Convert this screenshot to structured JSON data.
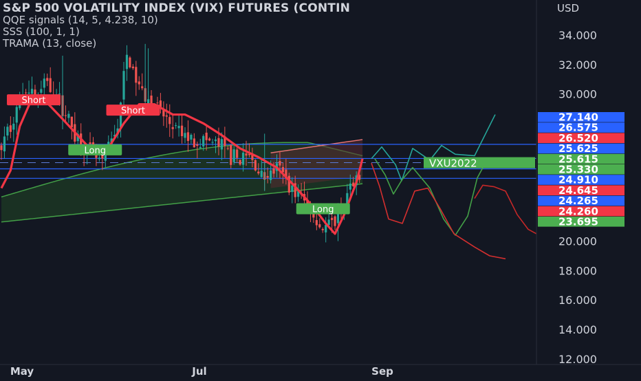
{
  "header": {
    "title": "S&P 500 VOLATILITY INDEX (VIX) FUTURES (CONTIN",
    "indicators": [
      "QQE signals (14, 5, 4.238, 10)",
      "SSS (100, 1, 1)",
      "TRAMA (13, close)"
    ],
    "currency": "USD"
  },
  "chart_data": {
    "type": "candlestick",
    "title": "S&P 500 VOLATILITY INDEX (VIX) FUTURES (CONTIN",
    "y_ticks": [
      "34.000",
      "32.000",
      "30.000",
      "22.000",
      "20.000",
      "18.000",
      "16.000",
      "14.000",
      "12.000"
    ],
    "x_ticks": [
      "May",
      "Jul",
      "Sep"
    ],
    "ylim": [
      11.5,
      36
    ],
    "price_tags": [
      {
        "label": "27.140",
        "color": "#2962ff"
      },
      {
        "label": "26.575",
        "color": "#2962ff"
      },
      {
        "label": "26.520",
        "color": "#f23645"
      },
      {
        "label": "25.625",
        "color": "#2962ff"
      },
      {
        "label": "25.615",
        "color": "#4caf50"
      },
      {
        "label": "25.330",
        "color": "#4caf50"
      },
      {
        "label": "24.910",
        "color": "#2962ff"
      },
      {
        "label": "24.645",
        "color": "#f23645"
      },
      {
        "label": "24.265",
        "color": "#2962ff"
      },
      {
        "label": "24.260",
        "color": "#f23645"
      },
      {
        "label": "23.695",
        "color": "#4caf50"
      }
    ],
    "signals": [
      {
        "label": "Short",
        "type": "short",
        "date": "May 05",
        "price": 29.6
      },
      {
        "label": "Short",
        "type": "short",
        "date": "Jun 08",
        "price": 28.9
      },
      {
        "label": "Long",
        "type": "long",
        "date": "May 26",
        "price": 26.2
      },
      {
        "label": "Long",
        "type": "long",
        "date": "Aug 12",
        "price": 22.2
      }
    ],
    "symbol_label": "VXU2022",
    "horizontal_lines": [
      {
        "price": 26.575,
        "color": "#2962ff"
      },
      {
        "price": 25.615,
        "color": "#2962ff"
      },
      {
        "price": 24.91,
        "color": "#2962ff"
      },
      {
        "price": 24.265,
        "color": "#2962ff"
      }
    ],
    "grid": false
  }
}
